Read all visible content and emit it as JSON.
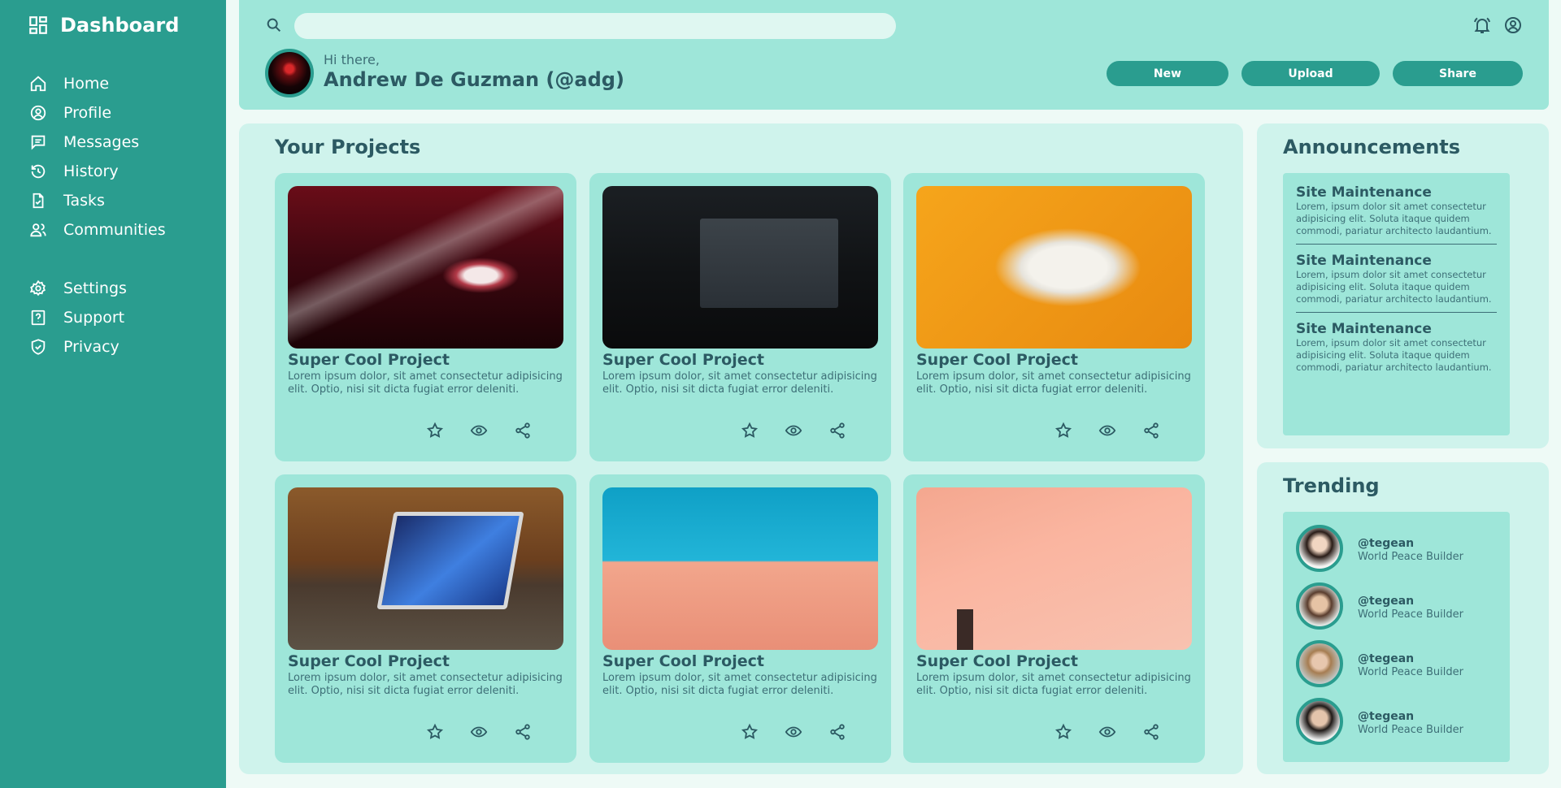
{
  "sidebar": {
    "brand": "Dashboard",
    "main_items": [
      {
        "label": "Home",
        "icon": "home-icon"
      },
      {
        "label": "Profile",
        "icon": "user-circle-icon"
      },
      {
        "label": "Messages",
        "icon": "chat-icon"
      },
      {
        "label": "History",
        "icon": "history-icon"
      },
      {
        "label": "Tasks",
        "icon": "task-file-icon"
      },
      {
        "label": "Communities",
        "icon": "users-icon"
      }
    ],
    "secondary_items": [
      {
        "label": "Settings",
        "icon": "gear-icon"
      },
      {
        "label": "Support",
        "icon": "help-icon"
      },
      {
        "label": "Privacy",
        "icon": "shield-icon"
      }
    ]
  },
  "header": {
    "search_placeholder": "",
    "greeting": "Hi there,",
    "username": "Andrew De Guzman (@adg)",
    "buttons": {
      "new": "New",
      "upload": "Upload",
      "share": "Share"
    }
  },
  "projects": {
    "title": "Your Projects",
    "cards": [
      {
        "title": "Super Cool Project",
        "desc": "Lorem ipsum dolor, sit amet consectetur adipisicing elit. Optio, nisi sit dicta fugiat error deleniti."
      },
      {
        "title": "Super Cool Project",
        "desc": "Lorem ipsum dolor, sit amet consectetur adipisicing elit. Optio, nisi sit dicta fugiat error deleniti."
      },
      {
        "title": "Super Cool Project",
        "desc": "Lorem ipsum dolor, sit amet consectetur adipisicing elit. Optio, nisi sit dicta fugiat error deleniti."
      },
      {
        "title": "Super Cool Project",
        "desc": "Lorem ipsum dolor, sit amet consectetur adipisicing elit. Optio, nisi sit dicta fugiat error deleniti."
      },
      {
        "title": "Super Cool Project",
        "desc": "Lorem ipsum dolor, sit amet consectetur adipisicing elit. Optio, nisi sit dicta fugiat error deleniti."
      },
      {
        "title": "Super Cool Project",
        "desc": "Lorem ipsum dolor, sit amet consectetur adipisicing elit. Optio, nisi sit dicta fugiat error deleniti."
      }
    ]
  },
  "announcements": {
    "title": "Announcements",
    "items": [
      {
        "title": "Site Maintenance",
        "text": "Lorem, ipsum dolor sit amet consectetur adipisicing elit. Soluta itaque quidem commodi, pariatur architecto laudantium."
      },
      {
        "title": "Site Maintenance",
        "text": "Lorem, ipsum dolor sit amet consectetur adipisicing elit. Soluta itaque quidem commodi, pariatur architecto laudantium."
      },
      {
        "title": "Site Maintenance",
        "text": "Lorem, ipsum dolor sit amet consectetur adipisicing elit. Soluta itaque quidem commodi, pariatur architecto laudantium."
      }
    ]
  },
  "trending": {
    "title": "Trending",
    "items": [
      {
        "handle": "@tegean",
        "role": "World Peace Builder"
      },
      {
        "handle": "@tegean",
        "role": "World Peace Builder"
      },
      {
        "handle": "@tegean",
        "role": "World Peace Builder"
      },
      {
        "handle": "@tegean",
        "role": "World Peace Builder"
      }
    ]
  },
  "colors": {
    "sidebar": "#2a9d8f",
    "header": "#9ee6d9",
    "panel": "#cff3ec",
    "text": "#2c5a63"
  }
}
